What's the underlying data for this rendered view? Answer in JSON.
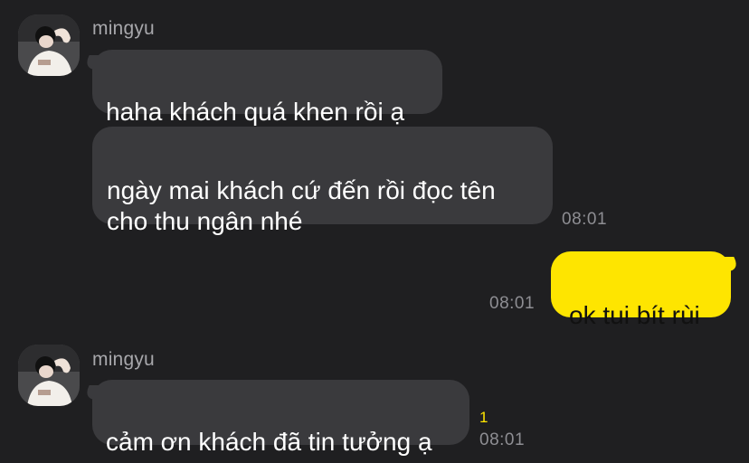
{
  "chat": {
    "messages": [
      {
        "sender": "mingyu",
        "avatar_icon": "profile-photo",
        "text": "haha khách quá khen rồi ạ"
      },
      {
        "sender": "mingyu",
        "text": "ngày mai khách cứ đến rồi đọc tên\ncho thu ngân nhé",
        "time": "08:01"
      },
      {
        "sender": "me",
        "text": "ok tui bít rùi",
        "time": "08:01"
      },
      {
        "sender": "mingyu",
        "avatar_icon": "profile-photo",
        "text": "cảm ơn khách đã tin tưởng ạ",
        "unread": "1",
        "time": "08:01"
      }
    ]
  },
  "colors": {
    "background": "#1f1f21",
    "incoming_bubble": "#3a3a3d",
    "outgoing_bubble": "#fee500",
    "unread_count": "#fee500"
  }
}
